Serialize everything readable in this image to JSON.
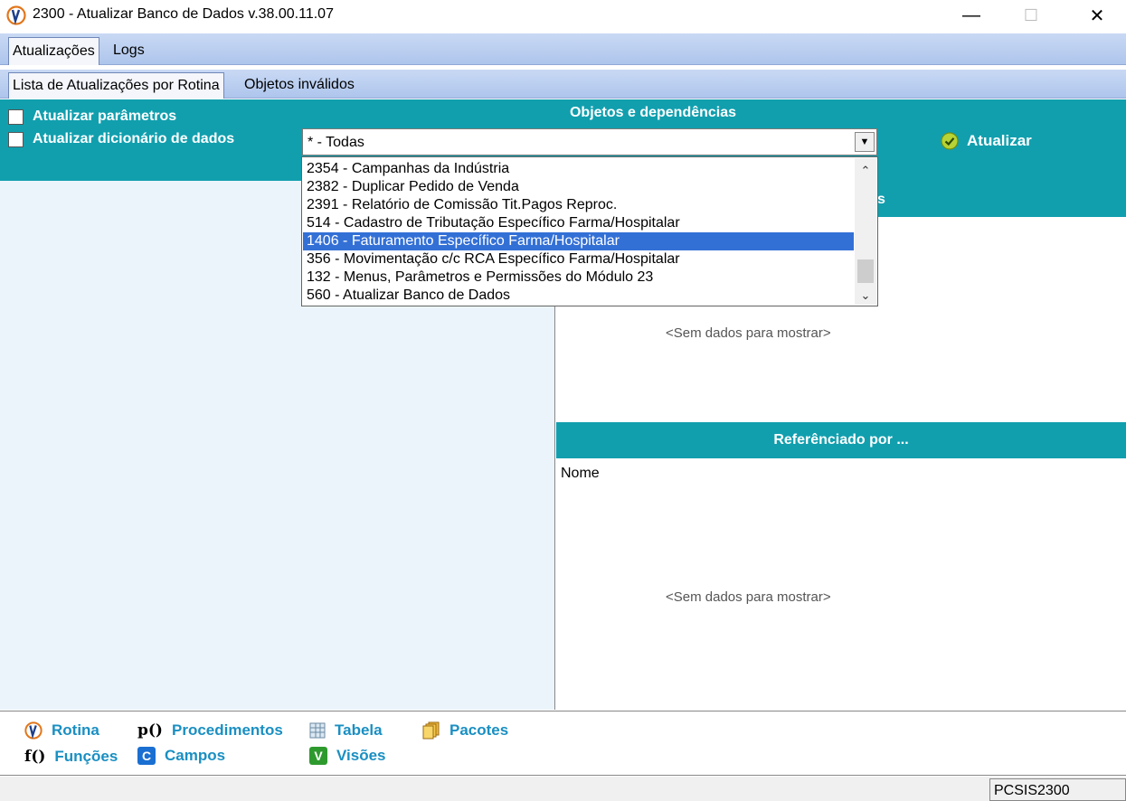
{
  "window": {
    "title": "2300 - Atualizar Banco de Dados v.38.00.11.07",
    "minimize": "—",
    "maximize": "☐",
    "close": "✕"
  },
  "tabs_main": [
    "Atualizações",
    "Logs"
  ],
  "tabs_sub": [
    "Lista de Atualizações por Rotina",
    "Objetos inválidos"
  ],
  "options": {
    "update_params": "Atualizar parâmetros",
    "update_dictionary": "Atualizar dicionário de dados"
  },
  "objects": {
    "heading": "Objetos e dependências",
    "selected": "* - Todas",
    "update_button": "Atualizar"
  },
  "dropdown": {
    "items": [
      "2354 - Campanhas da Indústria",
      "2382 - Duplicar Pedido de Venda",
      "2391 - Relatório de Comissão Tit.Pagos Reproc.",
      "514 - Cadastro de Tributação Específico Farma/Hospitalar",
      "1406 - Faturamento Específico Farma/Hospitalar",
      "356 - Movimentação c/c RCA Específico Farma/Hospitalar",
      "132 - Menus, Parâmetros e Permissões do Módulo 23",
      "560 - Atualizar Banco de Dados"
    ],
    "selected_index": 4
  },
  "dependencies_panel": {
    "header_visible_fragment": "s",
    "empty": "<Sem dados para mostrar>"
  },
  "referenced_panel": {
    "header": "Referênciado por ...",
    "column": "Nome",
    "empty": "<Sem dados para mostrar>"
  },
  "legend": {
    "rotina": "Rotina",
    "procedimentos": "Procedimentos",
    "tabela": "Tabela",
    "pacotes": "Pacotes",
    "funcoes": "Funções",
    "campos": "Campos",
    "visoes": "Visões",
    "icon_procedimentos": "p()",
    "icon_funcoes": "f()",
    "icon_campos": "C",
    "icon_visoes": "V"
  },
  "status": {
    "panel": "PCSIS2300"
  },
  "colors": {
    "teal": "#119fae",
    "tab_blue": "#aec5ec",
    "selection": "#3370d6",
    "legend_text": "#1a8fc2"
  }
}
